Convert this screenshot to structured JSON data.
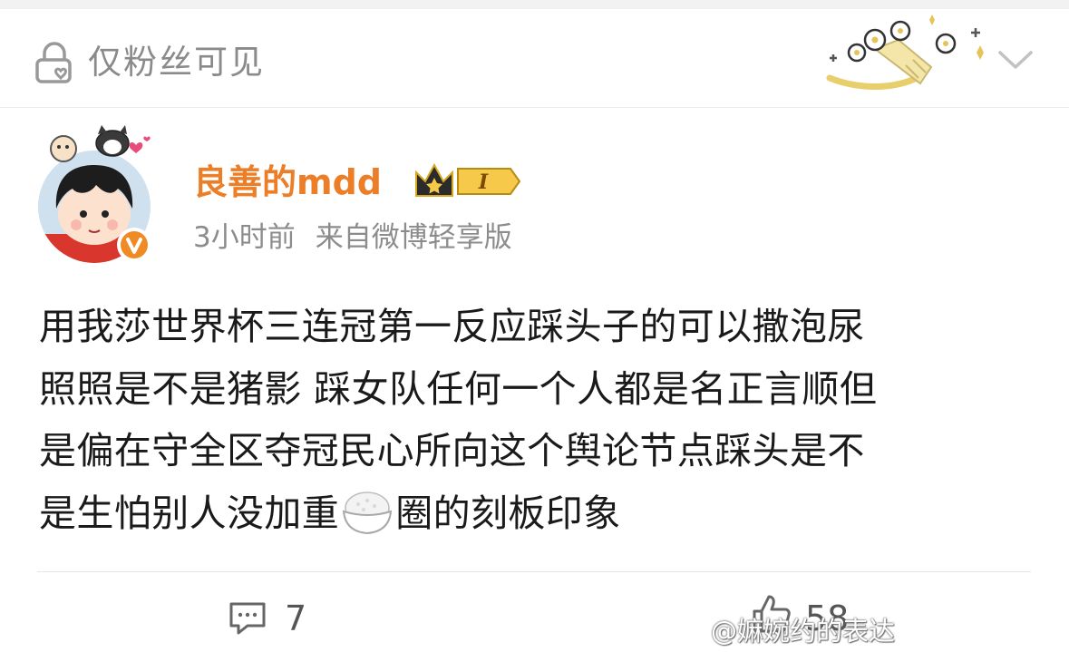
{
  "visibility": {
    "label": "仅粉丝可见",
    "icon": "lock-icon"
  },
  "post": {
    "username": "良善的mdd",
    "vip_level": "I",
    "time": "3小时前",
    "source": "来自微博轻享版",
    "lines": [
      "用我莎世界杯三连冠第一反应踩头子的可以撒泡尿",
      "照照是不是猪影 踩女队任何一个人都是名正言顺但",
      "是偏在守全区夺冠民心所向这个舆论节点踩头是不",
      "是生怕别人没加重"
    ],
    "line4_tail": "圈的刻板印象",
    "rice_emoji": "rice-bowl-icon"
  },
  "actions": {
    "comments": "7",
    "likes": "58"
  },
  "watermark": "@嫲婉约的表达",
  "colors": {
    "username": "#ec7e28",
    "secondary_text": "#8c8c8c",
    "body_text": "#1a1a1a",
    "vip_gold": "#f0b62a",
    "verified_orange": "#f08a24"
  }
}
